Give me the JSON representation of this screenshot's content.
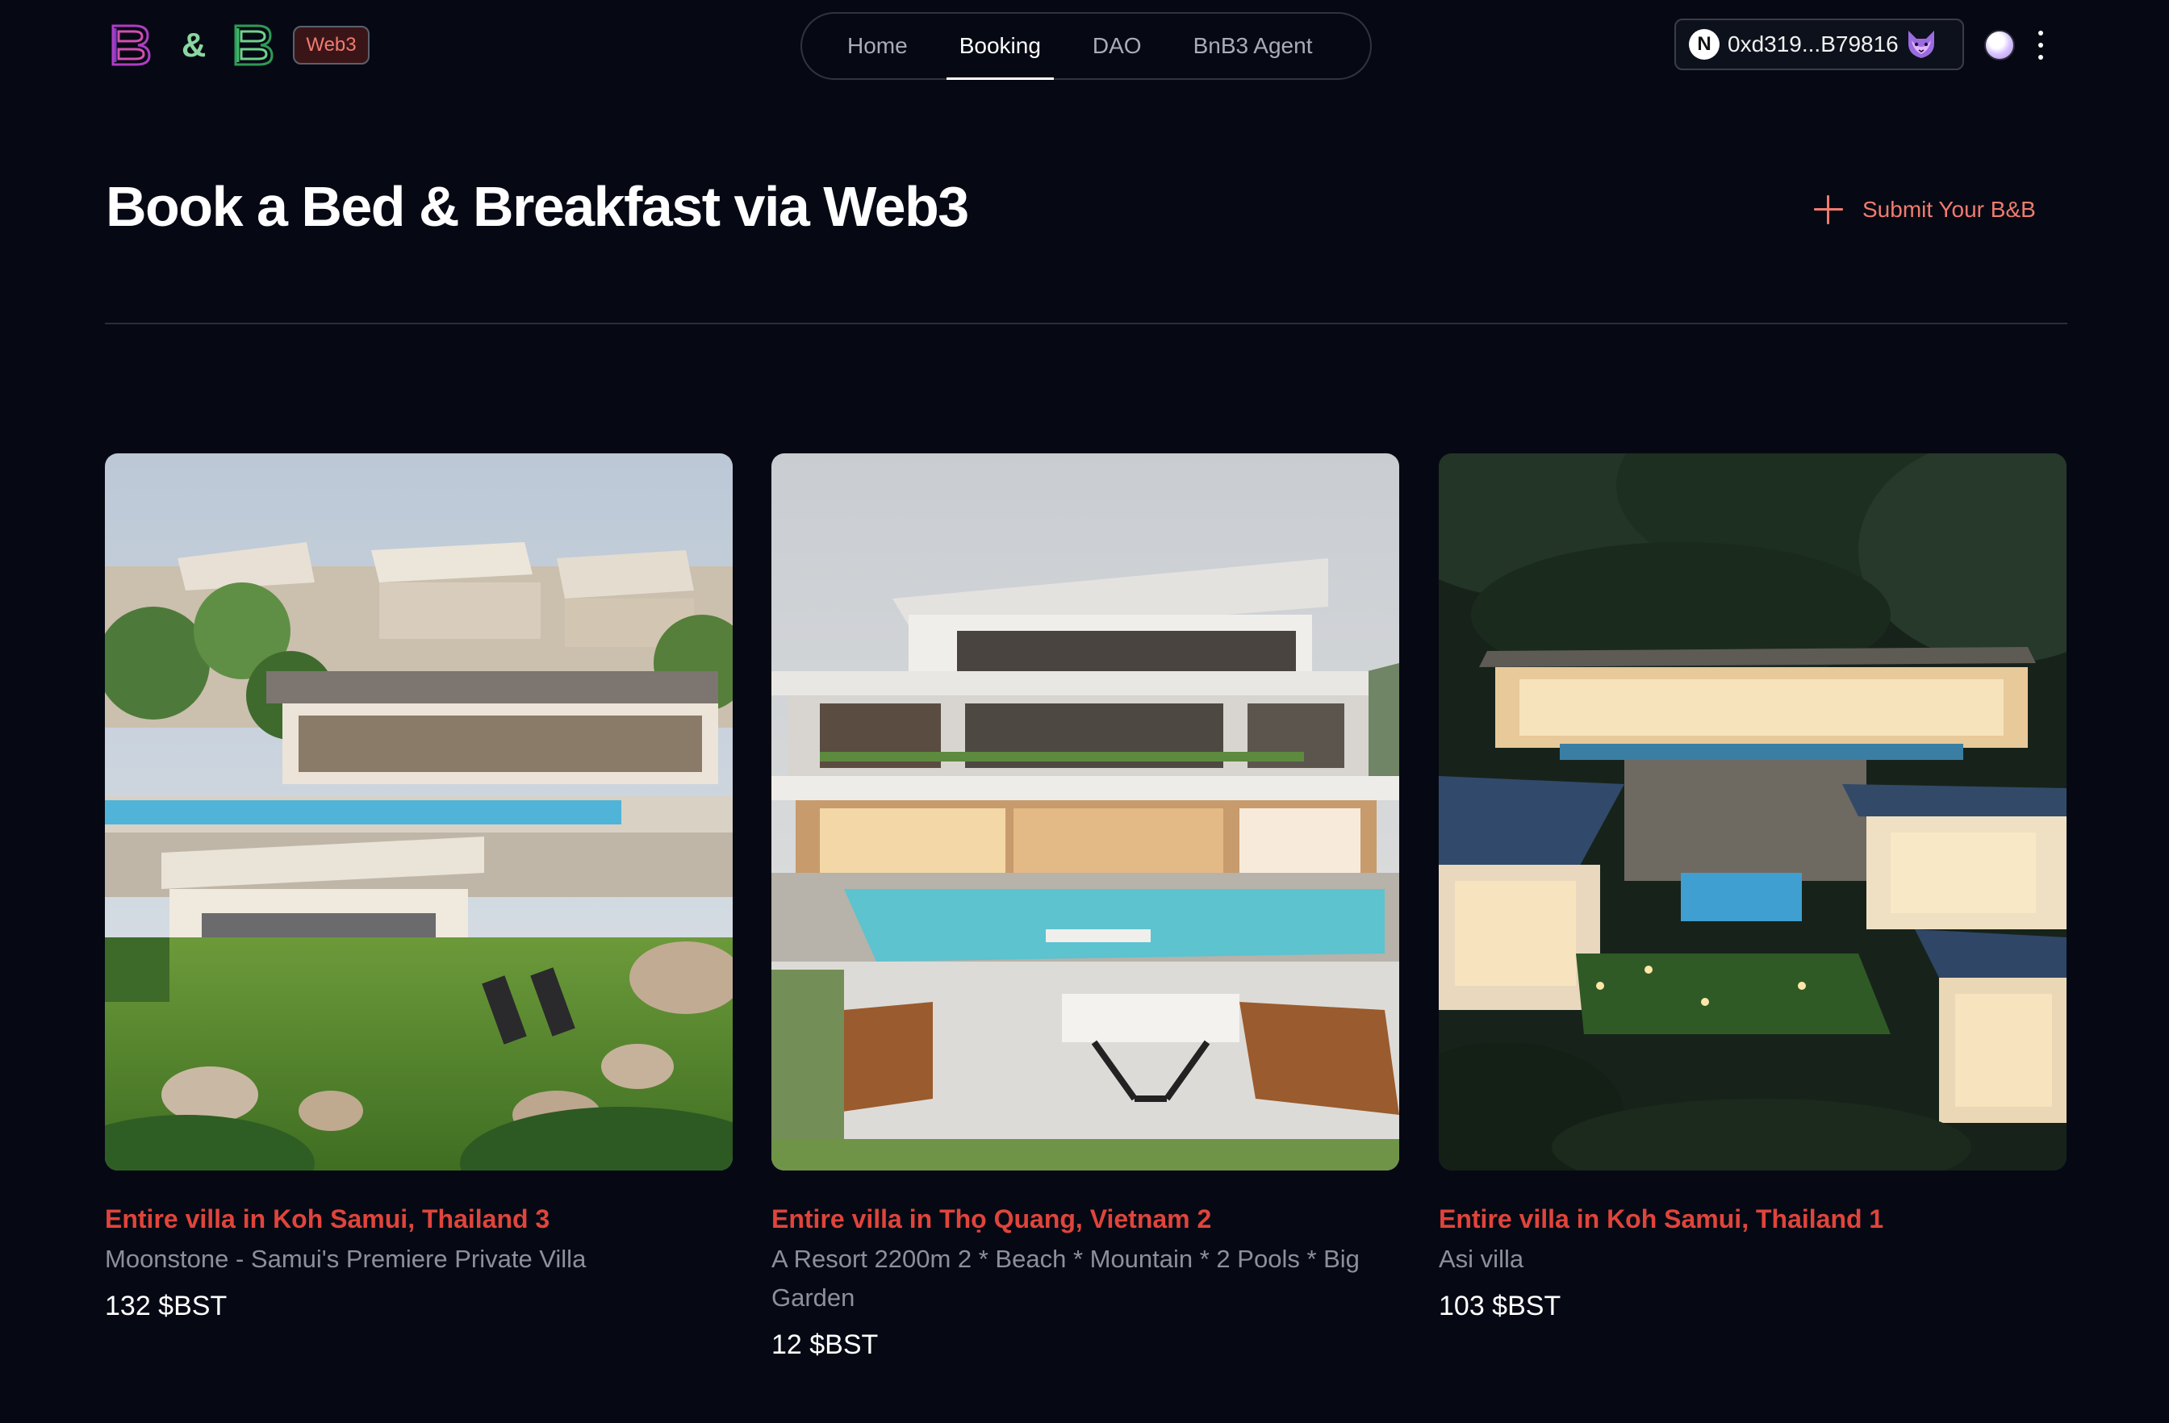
{
  "header": {
    "logo_amp": "&",
    "badge": "Web3",
    "nav": [
      {
        "label": "Home",
        "active": false
      },
      {
        "label": "Booking",
        "active": true
      },
      {
        "label": "DAO",
        "active": false
      },
      {
        "label": "BnB3 Agent",
        "active": false
      }
    ],
    "wallet": {
      "network_letter": "N",
      "address": "0xd319...B79816",
      "wallet_icon": "fox-icon"
    },
    "menu_icon": "kebab-icon"
  },
  "page": {
    "title": "Book a Bed & Breakfast via Web3",
    "submit_label": "Submit Your B&B",
    "accent": "#f07b6e"
  },
  "listings": [
    {
      "location": "Entire villa in Koh Samui, Thailand 3",
      "description": "Moonstone - Samui's Premiere Private Villa",
      "price": "132 $BST"
    },
    {
      "location": "Entire villa in Thọ Quang, Vietnam 2",
      "description": "A Resort 2200m 2 * Beach * Mountain * 2 Pools * Big Garden",
      "price": "12 $BST"
    },
    {
      "location": "Entire villa in Koh Samui, Thailand 1",
      "description": "Asi villa",
      "price": "103 $BST"
    }
  ]
}
